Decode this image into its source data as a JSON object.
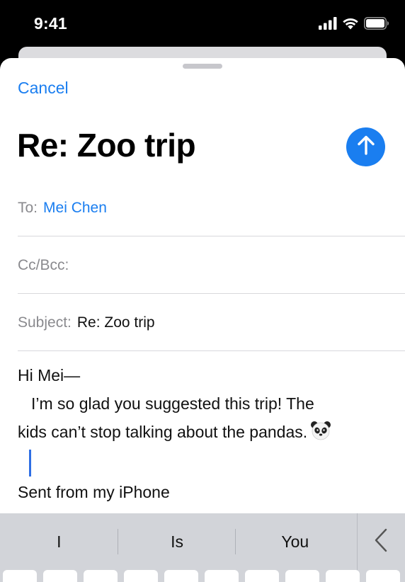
{
  "status_bar": {
    "time": "9:41"
  },
  "compose": {
    "cancel_label": "Cancel",
    "title": "Re: Zoo trip",
    "send_icon": "arrow-up-icon",
    "to_label": "To:",
    "to_value": "Mei Chen",
    "cc_label": "Cc/Bcc:",
    "subject_label": "Subject:",
    "subject_value": "Re: Zoo trip",
    "body": {
      "greeting": "Hi Mei—",
      "line1": "I’m so glad you suggested this trip! The",
      "line2": "kids can’t stop talking about the pandas.",
      "emoji": "panda-face-icon",
      "signature": "Sent from my iPhone"
    }
  },
  "keyboard": {
    "suggestions": [
      "I",
      "Is",
      "You"
    ],
    "collapse_icon": "chevron-left-icon"
  },
  "colors": {
    "accent": "#1a7ef0",
    "keyboard_bg": "#d2d4d9"
  }
}
